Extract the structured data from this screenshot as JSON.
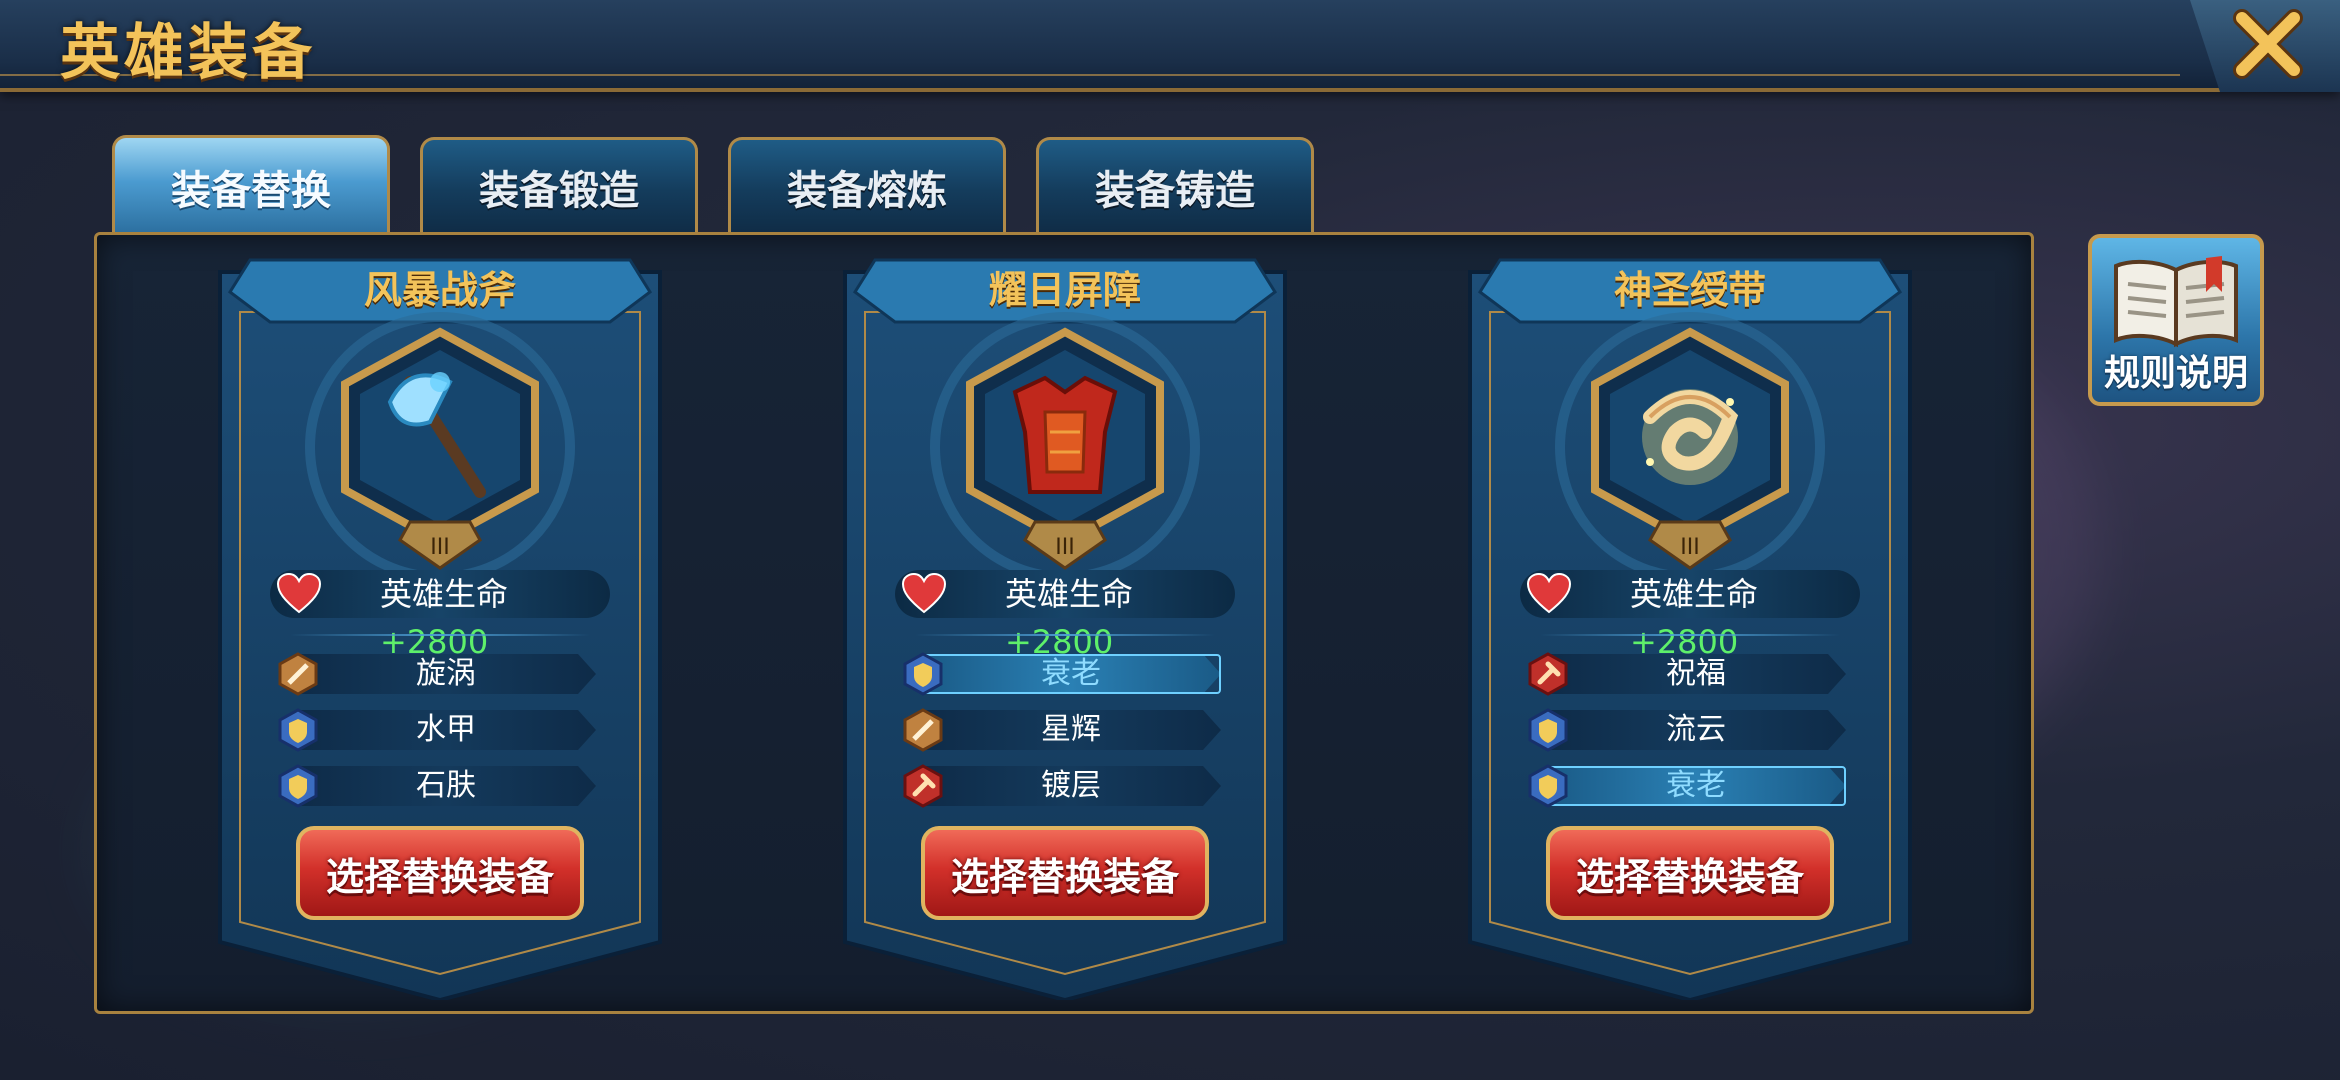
{
  "header": {
    "title": "英雄装备"
  },
  "tabs": [
    {
      "label": "装备替换",
      "active": true
    },
    {
      "label": "装备锻造",
      "active": false
    },
    {
      "label": "装备熔炼",
      "active": false
    },
    {
      "label": "装备铸造",
      "active": false
    }
  ],
  "rules": {
    "label": "规则说明"
  },
  "cards": [
    {
      "name": "风暴战斧",
      "stat_label": "英雄生命",
      "stat_value": "+2800",
      "skills": [
        {
          "label": "旋涡",
          "icon": "sword-icon",
          "highlighted": false
        },
        {
          "label": "水甲",
          "icon": "shield-icon",
          "highlighted": false
        },
        {
          "label": "石肤",
          "icon": "shield-icon",
          "highlighted": false
        }
      ],
      "button": "选择替换装备",
      "item_icon": "axe-icon"
    },
    {
      "name": "耀日屏障",
      "stat_label": "英雄生命",
      "stat_value": "+2800",
      "skills": [
        {
          "label": "衰老",
          "icon": "shield-icon",
          "highlighted": true
        },
        {
          "label": "星辉",
          "icon": "sword-icon",
          "highlighted": false
        },
        {
          "label": "镀层",
          "icon": "hammer-icon",
          "highlighted": false
        }
      ],
      "button": "选择替换装备",
      "item_icon": "armor-icon"
    },
    {
      "name": "神圣绶带",
      "stat_label": "英雄生命",
      "stat_value": "+2800",
      "skills": [
        {
          "label": "祝福",
          "icon": "hammer-icon",
          "highlighted": false
        },
        {
          "label": "流云",
          "icon": "shield-icon",
          "highlighted": false
        },
        {
          "label": "衰老",
          "icon": "shield-icon",
          "highlighted": true
        }
      ],
      "button": "选择替换装备",
      "item_icon": "sash-icon"
    }
  ],
  "colors": {
    "gold": "#f3c35a",
    "stat_green": "#5ef06a",
    "button_red": "#d2302a",
    "highlight": "#8fdcff"
  }
}
